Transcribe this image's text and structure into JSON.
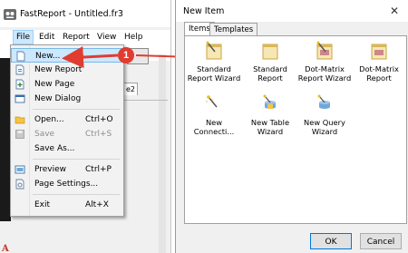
{
  "app": {
    "title": "FastReport - Untitled.fr3",
    "menubar": [
      "File",
      "Edit",
      "Report",
      "View",
      "Help"
    ],
    "active_menu": "File",
    "partial_tab_text": "e2",
    "file_menu": [
      {
        "label": "New...",
        "shortcut": "",
        "icon": "new-icon",
        "highlighted": true,
        "disabled": false
      },
      {
        "label": "New Report",
        "shortcut": "",
        "icon": "new-report-icon",
        "highlighted": false,
        "disabled": false
      },
      {
        "label": "New Page",
        "shortcut": "",
        "icon": "new-page-icon",
        "highlighted": false,
        "disabled": false
      },
      {
        "label": "New Dialog",
        "shortcut": "",
        "icon": "new-dialog-icon",
        "highlighted": false,
        "disabled": false
      },
      {
        "label": "Open...",
        "shortcut": "Ctrl+O",
        "icon": "open-folder-icon",
        "highlighted": false,
        "disabled": false
      },
      {
        "label": "Save",
        "shortcut": "Ctrl+S",
        "icon": "save-icon",
        "highlighted": false,
        "disabled": true
      },
      {
        "label": "Save As...",
        "shortcut": "",
        "icon": "",
        "highlighted": false,
        "disabled": false
      },
      {
        "label": "Preview",
        "shortcut": "Ctrl+P",
        "icon": "preview-icon",
        "highlighted": false,
        "disabled": false
      },
      {
        "label": "Page Settings...",
        "shortcut": "",
        "icon": "page-settings-icon",
        "highlighted": false,
        "disabled": false
      },
      {
        "label": "Exit",
        "shortcut": "Alt+X",
        "icon": "",
        "highlighted": false,
        "disabled": false
      }
    ]
  },
  "annotation": {
    "callout_number": "1",
    "color": "#e03c31"
  },
  "dialog": {
    "title": "New Item",
    "close_glyph": "✕",
    "tabs": [
      {
        "label": "Items",
        "selected": true
      },
      {
        "label": "Templates",
        "selected": false
      }
    ],
    "items": [
      {
        "label": "Standard Report Wizard",
        "icon": "report-wizard-icon"
      },
      {
        "label": "Standard Report",
        "icon": "report-icon"
      },
      {
        "label": "Dot-Matrix Report Wizard",
        "icon": "dot-matrix-wizard-icon"
      },
      {
        "label": "Dot-Matrix Report",
        "icon": "dot-matrix-report-icon"
      },
      {
        "label": "New Connecti...",
        "icon": "connection-wizard-icon"
      },
      {
        "label": "New Table Wizard",
        "icon": "table-wizard-icon"
      },
      {
        "label": "New Query Wizard",
        "icon": "query-wizard-icon"
      }
    ],
    "ok_label": "OK",
    "cancel_label": "Cancel"
  },
  "colors": {
    "highlight": "#cce8ff",
    "accent": "#0078d7"
  }
}
